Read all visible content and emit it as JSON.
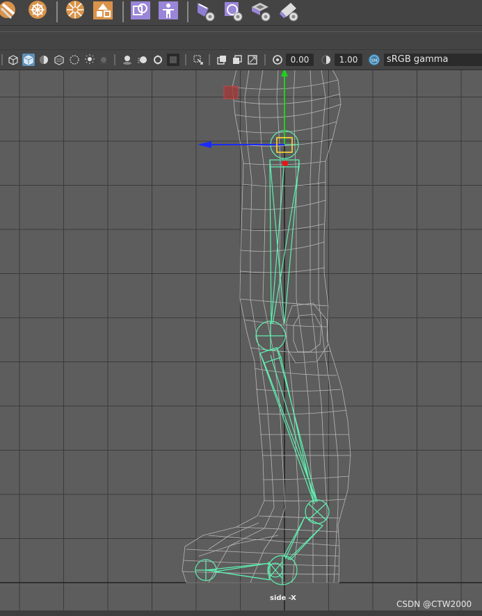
{
  "shelf": {
    "icons": [
      "rigid-bind-icon",
      "interactive-bind-icon",
      "paint-skin-weights-icon",
      "mirror-weights-icon",
      "copy-weights-icon",
      "human-ik-icon",
      "paint-tool-icon",
      "wrap-icon",
      "blend-shape-icon",
      "cluster-icon"
    ]
  },
  "panel_toolbar": {
    "exposure_value": "0.00",
    "gamma_value": "1.00",
    "color_space": "sRGB gamma",
    "color_space_badge": "SM"
  },
  "viewport": {
    "label": "side -X",
    "background": "#5d5d5d",
    "grid_color": "#3a3a3a",
    "axis_color": "#222222",
    "mesh_color": "#b8b8b8",
    "joint_color": "#5ff0b0",
    "manip_x_color": "#1a2bff",
    "manip_y_color": "#1fd11f",
    "pivot_color": "#ffdd33"
  },
  "watermark": "CSDN @CTW2000"
}
